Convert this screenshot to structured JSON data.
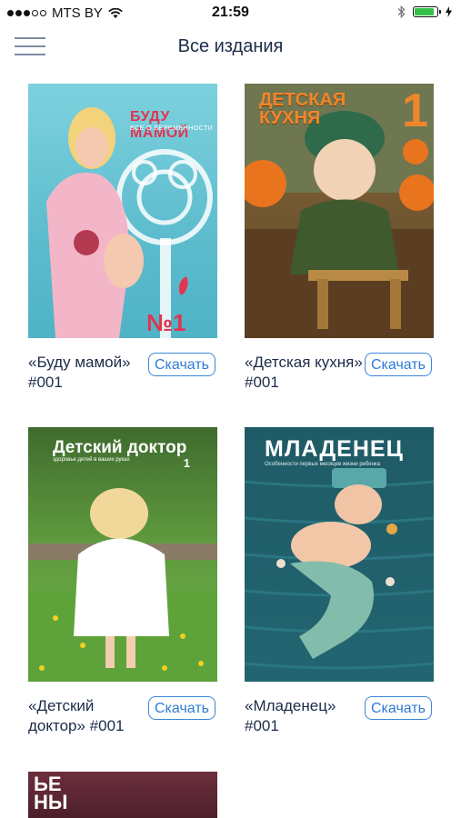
{
  "status_bar": {
    "carrier": "MTS BY",
    "time": "21:59",
    "battery_level": 0.95,
    "battery_color": "#35c24a"
  },
  "navbar": {
    "title": "Все издания",
    "menu_icon": "hamburger-icon"
  },
  "issues": [
    {
      "caption": "«Буду мамой» #001",
      "download_label": "Скачать",
      "cover": {
        "title": "БУДУ МАМОЙ",
        "subtitle": "ВСЕ О БЕРЕМЕННОСТИ",
        "number": "№1"
      }
    },
    {
      "caption": "«Детская кухня» #001",
      "download_label": "Скачать",
      "cover": {
        "title_line1": "ДЕТСКАЯ",
        "title_line2": "КУХНЯ",
        "number": "1"
      }
    },
    {
      "caption": "«Детский доктор» #001",
      "download_label": "Скачать",
      "cover": {
        "title": "Детский доктор",
        "subtitle": "здоровье детей в ваших руках",
        "number": "1"
      }
    },
    {
      "caption": "«Младенец» #001",
      "download_label": "Скачать",
      "cover": {
        "title": "МЛАДЕНЕЦ",
        "subtitle": "Особенности первых месяцев жизни ребенка"
      }
    },
    {
      "cover": {
        "title_line1": "ЬЕ",
        "title_line2": "НЫ"
      }
    }
  ],
  "colors": {
    "accent": "#2f7bd3",
    "title_text": "#1c2b48"
  }
}
